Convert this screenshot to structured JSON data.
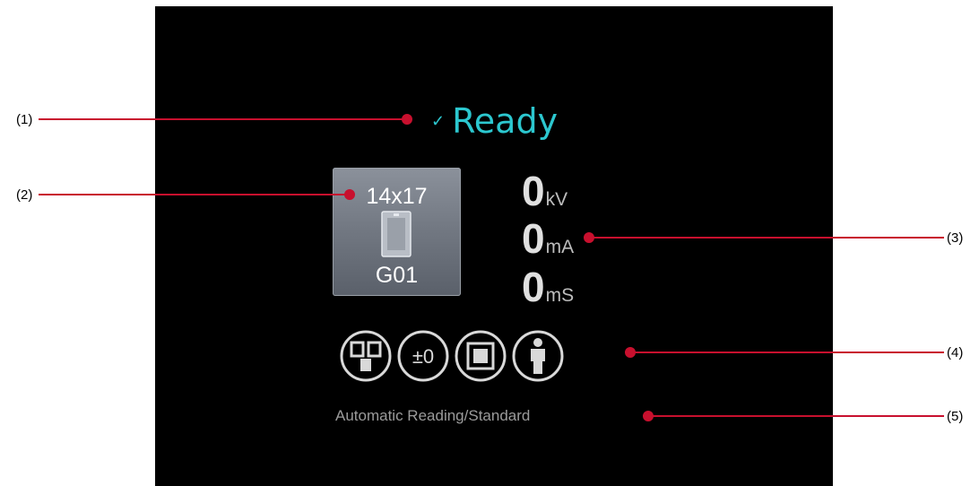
{
  "status": {
    "check": "✓",
    "text": "Ready"
  },
  "cassette": {
    "size": "14x17",
    "device": "G01"
  },
  "exposure": [
    {
      "value": "0",
      "unit": "kV"
    },
    {
      "value": "0",
      "unit": "mA"
    },
    {
      "value": "0",
      "unit": "mS"
    }
  ],
  "mode_icons": [
    {
      "name": "sensor-field-icon"
    },
    {
      "name": "density-icon",
      "label": "±0"
    },
    {
      "name": "detector-icon"
    },
    {
      "name": "patient-size-icon"
    }
  ],
  "reading_mode": "Automatic Reading/Standard",
  "callouts": [
    "(1)",
    "(2)",
    "(3)",
    "(4)",
    "(5)"
  ],
  "colors": {
    "accent": "#2cc7cf",
    "leader_line": "#c8102e",
    "screen": "#000000",
    "icon_stroke": "#d9d9d9"
  }
}
